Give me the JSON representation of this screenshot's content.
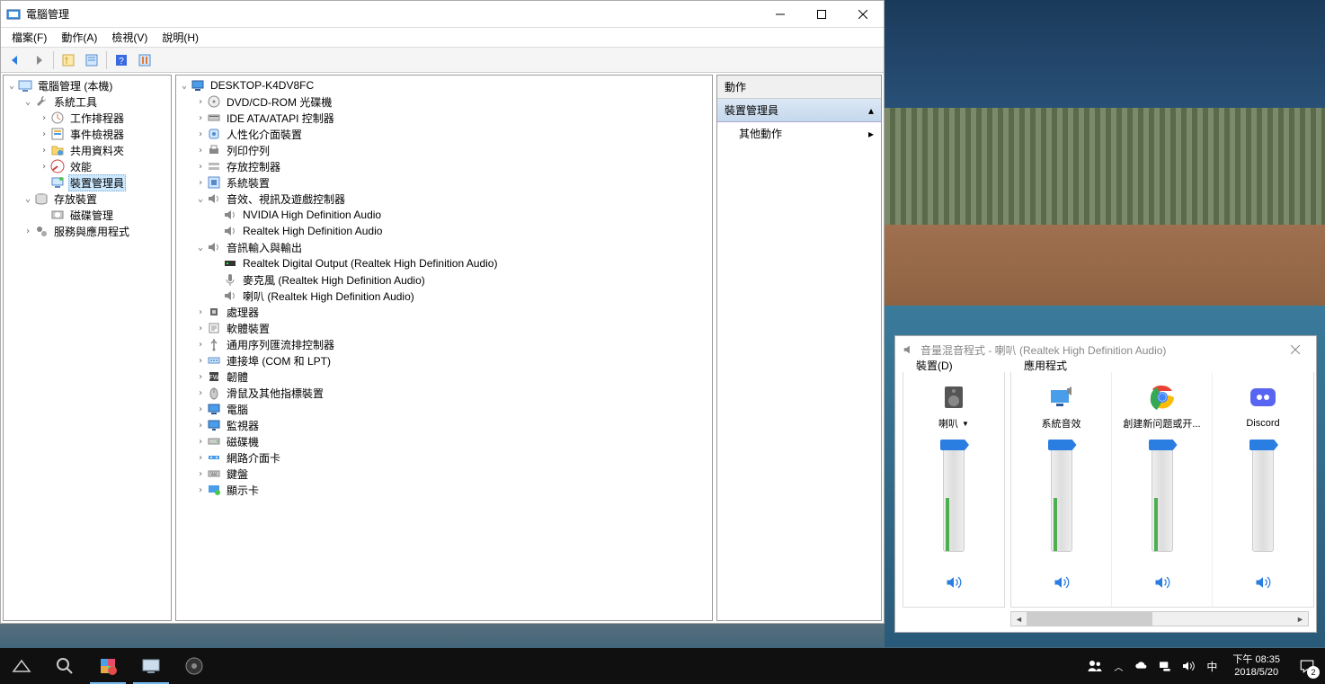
{
  "cm_window": {
    "title": "電腦管理",
    "menu": [
      "檔案(F)",
      "動作(A)",
      "檢視(V)",
      "說明(H)"
    ],
    "left_tree": [
      {
        "depth": 0,
        "exp": "v",
        "icon": "computer",
        "label": "電腦管理 (本機)"
      },
      {
        "depth": 1,
        "exp": "v",
        "icon": "wrench",
        "label": "系統工具"
      },
      {
        "depth": 2,
        "exp": ">",
        "icon": "scheduler",
        "label": "工作排程器"
      },
      {
        "depth": 2,
        "exp": ">",
        "icon": "event",
        "label": "事件檢視器"
      },
      {
        "depth": 2,
        "exp": ">",
        "icon": "folder-share",
        "label": "共用資料夾"
      },
      {
        "depth": 2,
        "exp": ">",
        "icon": "perf",
        "label": "效能"
      },
      {
        "depth": 2,
        "exp": "",
        "icon": "device",
        "label": "裝置管理員",
        "selected": true
      },
      {
        "depth": 1,
        "exp": "v",
        "icon": "storage",
        "label": "存放裝置"
      },
      {
        "depth": 2,
        "exp": "",
        "icon": "disk",
        "label": "磁碟管理"
      },
      {
        "depth": 1,
        "exp": ">",
        "icon": "services",
        "label": "服務與應用程式"
      }
    ],
    "device_tree": [
      {
        "depth": 0,
        "exp": "v",
        "icon": "pc",
        "label": "DESKTOP-K4DV8FC"
      },
      {
        "depth": 1,
        "exp": ">",
        "icon": "dvd",
        "label": "DVD/CD-ROM 光碟機"
      },
      {
        "depth": 1,
        "exp": ">",
        "icon": "ide",
        "label": "IDE ATA/ATAPI 控制器"
      },
      {
        "depth": 1,
        "exp": ">",
        "icon": "hid",
        "label": "人性化介面裝置"
      },
      {
        "depth": 1,
        "exp": ">",
        "icon": "printer",
        "label": "列印佇列"
      },
      {
        "depth": 1,
        "exp": ">",
        "icon": "storage-ctrl",
        "label": "存放控制器"
      },
      {
        "depth": 1,
        "exp": ">",
        "icon": "system",
        "label": "系統裝置"
      },
      {
        "depth": 1,
        "exp": "v",
        "icon": "sound",
        "label": "音效、視訊及遊戲控制器"
      },
      {
        "depth": 2,
        "exp": "",
        "icon": "speaker",
        "label": "NVIDIA High Definition Audio"
      },
      {
        "depth": 2,
        "exp": "",
        "icon": "speaker",
        "label": "Realtek High Definition Audio"
      },
      {
        "depth": 1,
        "exp": "v",
        "icon": "audio-io",
        "label": "音訊輸入與輸出"
      },
      {
        "depth": 2,
        "exp": "",
        "icon": "digital",
        "label": "Realtek Digital Output (Realtek High Definition Audio)"
      },
      {
        "depth": 2,
        "exp": "",
        "icon": "mic",
        "label": "麥克風 (Realtek High Definition Audio)"
      },
      {
        "depth": 2,
        "exp": "",
        "icon": "speaker",
        "label": "喇叭 (Realtek High Definition Audio)"
      },
      {
        "depth": 1,
        "exp": ">",
        "icon": "cpu",
        "label": "處理器"
      },
      {
        "depth": 1,
        "exp": ">",
        "icon": "software",
        "label": "軟體裝置"
      },
      {
        "depth": 1,
        "exp": ">",
        "icon": "usb",
        "label": "通用序列匯流排控制器"
      },
      {
        "depth": 1,
        "exp": ">",
        "icon": "port",
        "label": "連接埠 (COM 和 LPT)"
      },
      {
        "depth": 1,
        "exp": ">",
        "icon": "firmware",
        "label": "韌體"
      },
      {
        "depth": 1,
        "exp": ">",
        "icon": "mouse",
        "label": "滑鼠及其他指標裝置"
      },
      {
        "depth": 1,
        "exp": ">",
        "icon": "pc",
        "label": "電腦"
      },
      {
        "depth": 1,
        "exp": ">",
        "icon": "monitor",
        "label": "監視器"
      },
      {
        "depth": 1,
        "exp": ">",
        "icon": "diskdrive",
        "label": "磁碟機"
      },
      {
        "depth": 1,
        "exp": ">",
        "icon": "network",
        "label": "網路介面卡"
      },
      {
        "depth": 1,
        "exp": ">",
        "icon": "keyboard",
        "label": "鍵盤"
      },
      {
        "depth": 1,
        "exp": ">",
        "icon": "display",
        "label": "顯示卡"
      }
    ],
    "actions": {
      "header": "動作",
      "section": "裝置管理員",
      "more": "其他動作"
    }
  },
  "mixer": {
    "title": "音量混音程式 - 喇叭 (Realtek High Definition Audio)",
    "device_tab": "裝置(D)",
    "app_tab": "應用程式",
    "channels": [
      {
        "name": "喇叭",
        "icon": "speaker-device",
        "level": 50,
        "thumb": 100,
        "dropdown": true
      },
      {
        "name": "系統音效",
        "icon": "system-sounds",
        "level": 50,
        "thumb": 100
      },
      {
        "name": "創建新问题或开...",
        "icon": "chrome",
        "level": 50,
        "thumb": 100
      },
      {
        "name": "Discord",
        "icon": "discord",
        "level": 0,
        "thumb": 100
      }
    ]
  },
  "taskbar": {
    "time": "下午 08:35",
    "date": "2018/5/20",
    "ime": "中",
    "notif_count": "2"
  }
}
